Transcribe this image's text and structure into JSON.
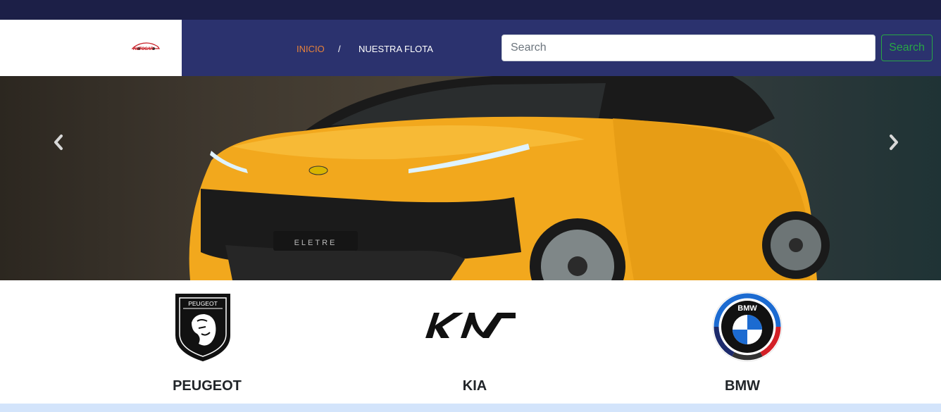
{
  "nav": {
    "logo_text": "AUTOCAR",
    "links": [
      {
        "label": "INICIO",
        "active": true
      },
      {
        "label": "NUESTRA FLOTA",
        "active": false
      }
    ],
    "separator": "/"
  },
  "search": {
    "placeholder": "Search",
    "button_label": "Search"
  },
  "carousel": {
    "prev_icon": "chevron-left-icon",
    "next_icon": "chevron-right-icon",
    "slide_badge_text": "ELETRE"
  },
  "brands": [
    {
      "name": "PEUGEOT",
      "logo_text": "PEUGEOT",
      "icon": "peugeot-logo"
    },
    {
      "name": "KIA",
      "icon": "kia-logo"
    },
    {
      "name": "BMW",
      "logo_text": "BMW",
      "icon": "bmw-logo"
    }
  ],
  "colors": {
    "topbar": "#1c1f47",
    "navbar": "#2b326e",
    "active_link": "#e8823a",
    "search_button": "#28a745",
    "car_body": "#f2a81d",
    "footer_strip": "#d3e4fb"
  }
}
